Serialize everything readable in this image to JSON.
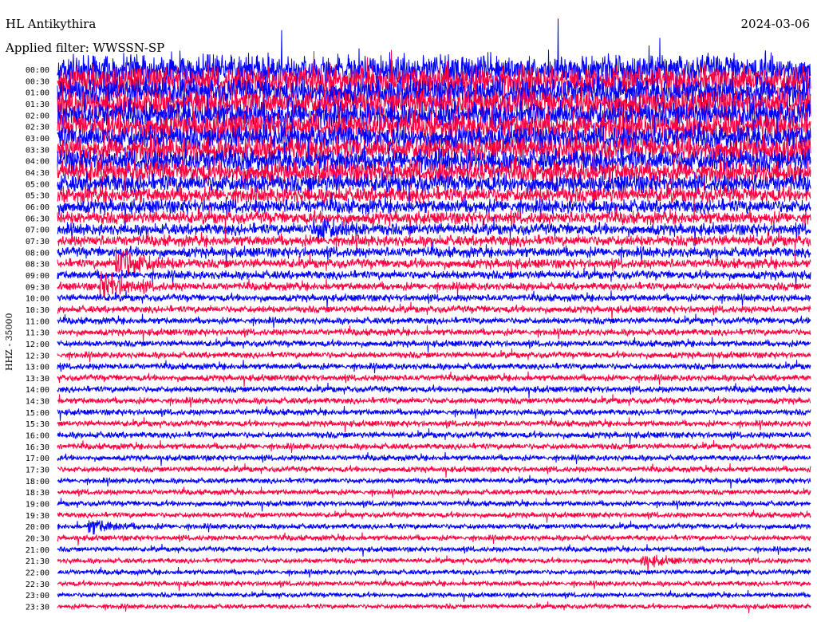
{
  "header": {
    "station": "HL Antikythira",
    "date": "2024-03-06",
    "filter": "Applied filter: WWSSN-SP"
  },
  "chart_data": {
    "type": "line",
    "title": "HL Antikythira",
    "subtitle": "Applied filter: WWSSN-SP",
    "ylabel": "HHZ - 35000",
    "xlabel": "",
    "minutes_per_row": 30,
    "row_labels": [
      "00:00",
      "00:30",
      "01:00",
      "01:30",
      "02:00",
      "02:30",
      "03:00",
      "03:30",
      "04:00",
      "04:30",
      "05:00",
      "05:30",
      "06:00",
      "06:30",
      "07:00",
      "07:30",
      "08:00",
      "08:30",
      "09:00",
      "09:30",
      "10:00",
      "10:30",
      "11:00",
      "11:30",
      "12:00",
      "12:30",
      "13:00",
      "13:30",
      "14:00",
      "14:30",
      "15:00",
      "15:30",
      "16:00",
      "16:30",
      "17:00",
      "17:30",
      "18:00",
      "18:30",
      "19:00",
      "19:30",
      "20:00",
      "20:30",
      "21:00",
      "21:30",
      "22:00",
      "22:30",
      "23:00",
      "23:30"
    ],
    "series_colors": [
      "#0000ff",
      "#ff0040"
    ],
    "relative_amplitude": [
      1.9,
      1.9,
      1.8,
      1.8,
      1.7,
      1.7,
      1.6,
      1.6,
      1.5,
      1.4,
      1.2,
      1.0,
      0.9,
      0.8,
      0.75,
      0.7,
      0.65,
      0.6,
      0.55,
      0.5,
      0.45,
      0.45,
      0.42,
      0.42,
      0.4,
      0.4,
      0.4,
      0.4,
      0.4,
      0.4,
      0.38,
      0.38,
      0.4,
      0.38,
      0.36,
      0.36,
      0.34,
      0.34,
      0.34,
      0.34,
      0.34,
      0.34,
      0.32,
      0.32,
      0.32,
      0.32,
      0.3,
      0.3
    ],
    "events": [
      {
        "row": "07:00",
        "minute": 10.5,
        "relative_amplitude": 1.3
      },
      {
        "row": "08:30",
        "minute": 2.6,
        "relative_amplitude": 2.0
      },
      {
        "row": "09:30",
        "minute": 2.0,
        "relative_amplitude": 1.6
      },
      {
        "row": "20:00",
        "minute": 1.5,
        "relative_amplitude": 0.8
      },
      {
        "row": "21:30",
        "minute": 23.5,
        "relative_amplitude": 0.6
      }
    ]
  }
}
